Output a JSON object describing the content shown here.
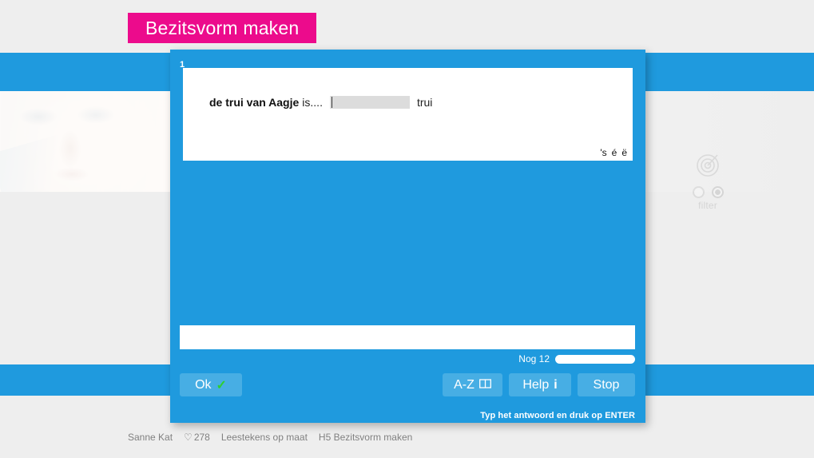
{
  "banner": {
    "title": "Bezitsvorm maken"
  },
  "background": {
    "filter_widget": {
      "icon": "target-icon",
      "label": "filter",
      "options": [
        {
          "label": "",
          "selected": false
        },
        {
          "label": "",
          "selected": true
        }
      ]
    }
  },
  "dialog": {
    "question_number": "1",
    "question": {
      "lead": "de trui van Aagje",
      "middle": "is....",
      "gap_value": "",
      "tail": "trui"
    },
    "special_chars": [
      "'s",
      "é",
      "ë"
    ],
    "answer": {
      "value": "",
      "placeholder": ""
    },
    "progress": {
      "label": "Nog 12",
      "remaining": 12,
      "percent": 100
    },
    "buttons": {
      "ok": "Ok",
      "ok_icon": "✓",
      "az": "A-Z",
      "az_icon": "📖",
      "help": "Help",
      "help_icon": "i",
      "stop": "Stop"
    },
    "hint": "Typ het antwoord en druk op ENTER"
  },
  "footer": {
    "author": "Sanne Kat",
    "heart_icon": "♡",
    "likes": "278",
    "collection": "Leestekens op maat",
    "chapter": "H5 Bezitsvorm maken"
  },
  "colors": {
    "accent_blue": "#1f9ade",
    "banner_pink": "#ec0b8c",
    "button_blue": "#47aee4",
    "check_green": "#2fcf2f",
    "page_bg": "#eeeeee"
  }
}
